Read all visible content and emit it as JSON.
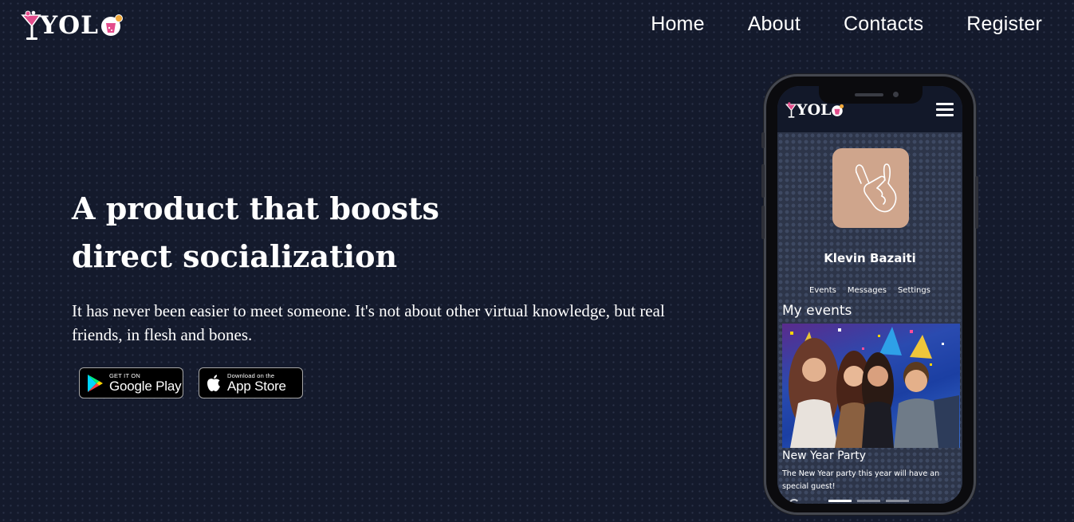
{
  "brand": {
    "logo_text": "YOL",
    "colors": {
      "background": "#141a2c",
      "accent_pink": "#e34c8c",
      "text": "#ffffff"
    }
  },
  "nav": {
    "items": [
      {
        "label": "Home"
      },
      {
        "label": "About"
      },
      {
        "label": "Contacts"
      },
      {
        "label": "Register"
      }
    ]
  },
  "hero": {
    "title": "A product that boosts direct socialization",
    "subtitle": "It has never been easier to meet someone. It's not about other virtual knowledge, but real friends, in flesh and bones."
  },
  "store_buttons": {
    "google_play": {
      "small": "GET IT ON",
      "big": "Google Play",
      "icon": "google-play-icon"
    },
    "app_store": {
      "small": "Download on the",
      "big": "App Store",
      "icon": "apple-icon"
    }
  },
  "phone_app": {
    "logo_text": "YOL",
    "menu_icon": "hamburger-icon",
    "profile": {
      "name": "Klevin Bazaiti",
      "avatar_icon": "shaka-hand-icon",
      "tabs": [
        {
          "label": "Events"
        },
        {
          "label": "Messages"
        },
        {
          "label": "Settings"
        }
      ]
    },
    "section_title": "My events",
    "event": {
      "title": "New Year Party",
      "description": "The New Year party this year will have an special guest!"
    },
    "carousel": {
      "total": 3,
      "active": 1
    }
  }
}
